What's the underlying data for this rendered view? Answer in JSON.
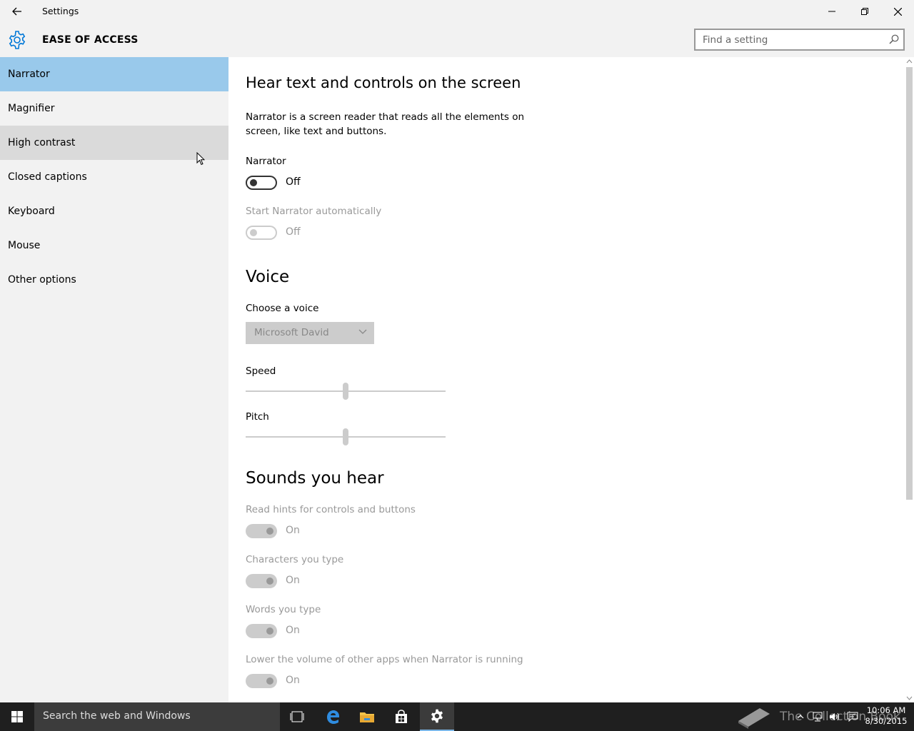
{
  "window": {
    "title": "Settings",
    "controls": {
      "minimize": "minimize",
      "maximize": "restore",
      "close": "close"
    }
  },
  "header": {
    "section": "EASE OF ACCESS",
    "search_placeholder": "Find a setting"
  },
  "sidebar": {
    "items": [
      {
        "label": "Narrator",
        "state": "selected"
      },
      {
        "label": "Magnifier",
        "state": "normal"
      },
      {
        "label": "High contrast",
        "state": "hover"
      },
      {
        "label": "Closed captions",
        "state": "normal"
      },
      {
        "label": "Keyboard",
        "state": "normal"
      },
      {
        "label": "Mouse",
        "state": "normal"
      },
      {
        "label": "Other options",
        "state": "normal"
      }
    ]
  },
  "main": {
    "heading": "Hear text and controls on the screen",
    "description": "Narrator is a screen reader that reads all the elements on screen, like text and buttons.",
    "narrator": {
      "label": "Narrator",
      "state": "Off",
      "enabled": true
    },
    "auto_start": {
      "label": "Start Narrator automatically",
      "state": "Off",
      "enabled": false
    },
    "voice": {
      "heading": "Voice",
      "choose_label": "Choose a voice",
      "selected_voice": "Microsoft David",
      "speed_label": "Speed",
      "speed_value_pct": 50,
      "pitch_label": "Pitch",
      "pitch_value_pct": 50
    },
    "sounds": {
      "heading": "Sounds you hear",
      "items": [
        {
          "label": "Read hints for controls and buttons",
          "state": "On"
        },
        {
          "label": "Characters you type",
          "state": "On"
        },
        {
          "label": "Words you type",
          "state": "On"
        },
        {
          "label": "Lower the volume of other apps when Narrator is running",
          "state": "On"
        }
      ]
    }
  },
  "taskbar": {
    "search_text": "Search the web and Windows",
    "watermark": "The Collection Book",
    "time": "10:06 AM",
    "date": "8/30/2015"
  },
  "colors": {
    "accent": "#0078d7",
    "selected_nav": "#99c9eb",
    "hover_nav": "#dadada",
    "sidebar_bg": "#f2f2f2",
    "taskbar_bg": "#1f1f1f"
  }
}
